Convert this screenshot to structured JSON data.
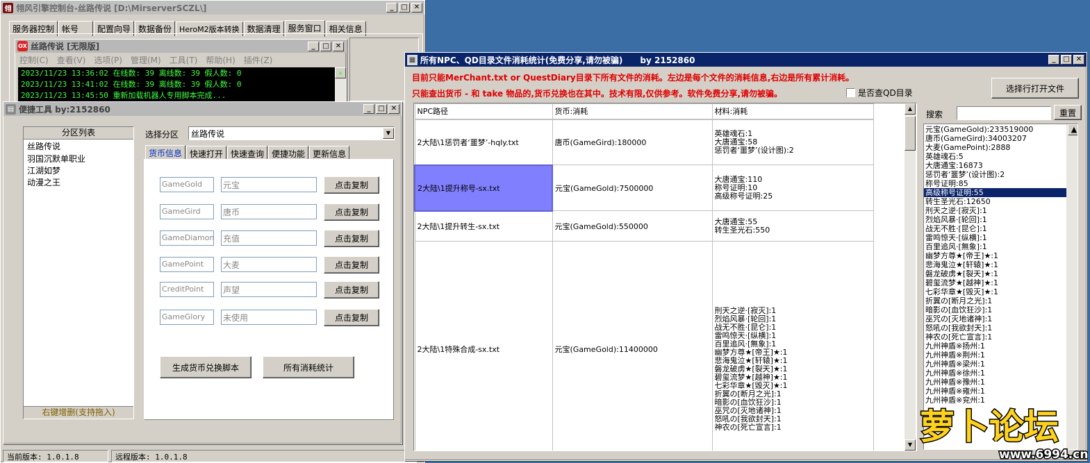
{
  "main": {
    "title": "翎风引擎控制台-丝路传说  [D:\\MirserverSCZL\\]",
    "tabs": [
      "服务器控制",
      "帐号",
      "配置向导",
      "数据备份",
      "HeroM2版本转换",
      "数据清理",
      "服务窗口",
      "相关信息"
    ],
    "sub": {
      "title": "丝路传说 [无限版]",
      "menu": [
        "控制(C)",
        "查看(V)",
        "选项(P)",
        "管理(M)",
        "工具(T)",
        "帮助(H)",
        "插件(Z)"
      ],
      "logs": [
        "2023/11/23 13:36:02 在线数: 39 离线数: 39 假人数: 0",
        "2023/11/23 13:41:02 在线数: 39 离线数: 39 假人数: 0",
        "2023/11/23 13:45:50 重新加载机器人专用脚本完成..."
      ]
    },
    "status_local": "当前版本: 1.0.1.8",
    "status_remote": "远程版本: 1.0.1.8"
  },
  "tool": {
    "title": "便捷工具  by:2152860",
    "partition_header": "分区列表",
    "partitions": [
      "丝路传说",
      "羽国沉默单职业",
      "江湖如梦",
      "动漫之王"
    ],
    "partition_footer": "右键增删(支持拖入)",
    "select_label": "选择分区",
    "select_value": "丝路传说",
    "tabs": [
      "货币信息",
      "快速打开",
      "快速查询",
      "便捷功能",
      "更新信息"
    ],
    "currency_rows": [
      {
        "key": "GameGold",
        "name": "元宝",
        "btn": "点击复制"
      },
      {
        "key": "GameGird",
        "name": "唐币",
        "btn": "点击复制"
      },
      {
        "key": "GameDiamond",
        "name": "充值",
        "btn": "点击复制"
      },
      {
        "key": "GamePoint",
        "name": "大麦",
        "btn": "点击复制"
      },
      {
        "key": "CreditPoint",
        "name": "声望",
        "btn": "点击复制"
      },
      {
        "key": "GameGlory",
        "name": "未使用",
        "btn": "点击复制"
      }
    ],
    "btn_generate": "生成货币兑换脚本",
    "btn_stats": "所有消耗统计"
  },
  "stats": {
    "title": "所有NPC、QD目录文件消耗统计(免费分享,请勿被骗)      by 2152860",
    "note1": "目前只能MerChant.txt or QuestDiary目录下所有文件的消耗。左边是每个文件的消耗信息,右边是所有累计消耗。",
    "note2": "只能查出货币 - 和 take 物品的,货币兑换也在其中。技术有限,仅供参考。软件免费分享,请勿被骗。",
    "checkbox_label": "是否查QD目录",
    "open_btn": "选择行打开文件",
    "search_label": "搜索",
    "reset_btn": "重置",
    "columns": [
      "NPC路径",
      "货币:消耗",
      "材料:消耗"
    ],
    "rows": [
      {
        "path": "2大陆\\1惩罚者‘噩梦’-hqly.txt",
        "currency": "唐币(GameGird):180000",
        "materials": [
          "英雄魂石:1",
          "大唐通宝:58",
          "惩罚者‘噩梦’(设计图):2"
        ]
      },
      {
        "path": "2大陆\\1提升称号-sx.txt",
        "currency": "元宝(GameGold):7500000",
        "materials": [
          "大唐通宝:110",
          "称号证明:10",
          "高级称号证明:25"
        ]
      },
      {
        "path": "2大陆\\1提升转生-sx.txt",
        "currency": "元宝(GameGold):550000",
        "materials": [
          "大唐通宝:55",
          "转生圣光石:550"
        ]
      },
      {
        "path": "2大陆\\1特殊合成-sx.txt",
        "currency": "元宝(GameGold):11400000",
        "materials": [
          "刑天之逆·[寂灭]:1",
          "烈焰风暴·[轮回]:1",
          "战无不胜·[昆仑]:1",
          "雷鸣惊天·[纵横]:1",
          "百里追风·[無象]:1",
          "幽梦方尊★[帝王]★:1",
          "悲海鬼泣★[轩辕]★:1",
          "磐龙破虏★[裂天]★:1",
          "碧玺流梦★[越神]★:1",
          "七彩华章★[毁灭]★:1",
          "折翼の[断月之光]:1",
          "暗影の[血饮狂沙]:1",
          "巫咒の[灭地诸神]:1",
          "怒吼の[我欲封天]:1",
          "神农の[死亡宣言]:1"
        ]
      }
    ],
    "totals": [
      "元宝(GameGold):233519000",
      "唐币(GameGird):34003207",
      "大麦(GamePoint):2888",
      "英雄魂石:5",
      "大唐通宝:16873",
      "惩罚者‘噩梦’(设计图):2",
      "称号证明:85",
      "高级称号证明:55",
      "转生圣光石:12650",
      "刑天之逆·[寂灭]:1",
      "烈焰风暴·[轮回]:1",
      "战无不胜·[昆仑]:1",
      "雷鸣惊天·[纵横]:1",
      "百里追风·[無象]:1",
      "幽梦方尊★[帝王]★:1",
      "悲海鬼泣★[轩辕]★:1",
      "磐龙破虏★[裂天]★:1",
      "碧玺流梦★[越神]★:1",
      "七彩华章★[毁灭]★:1",
      "折翼の[断月之光]:1",
      "暗影の[血饮狂沙]:1",
      "巫咒の[灭地诸神]:1",
      "怒吼の[我欲封天]:1",
      "神农の[死亡宣言]:1",
      "九州神盾※扬州:1",
      "九州神盾※荆州:1",
      "九州神盾※梁州:1",
      "九州神盾※徐州:1",
      "九州神盾※豫州:1",
      "九州神盾※雍州:1",
      "九州神盾※兖州:1"
    ]
  },
  "watermark": {
    "logo": "萝卜论坛",
    "url": "www.6994.cn"
  }
}
